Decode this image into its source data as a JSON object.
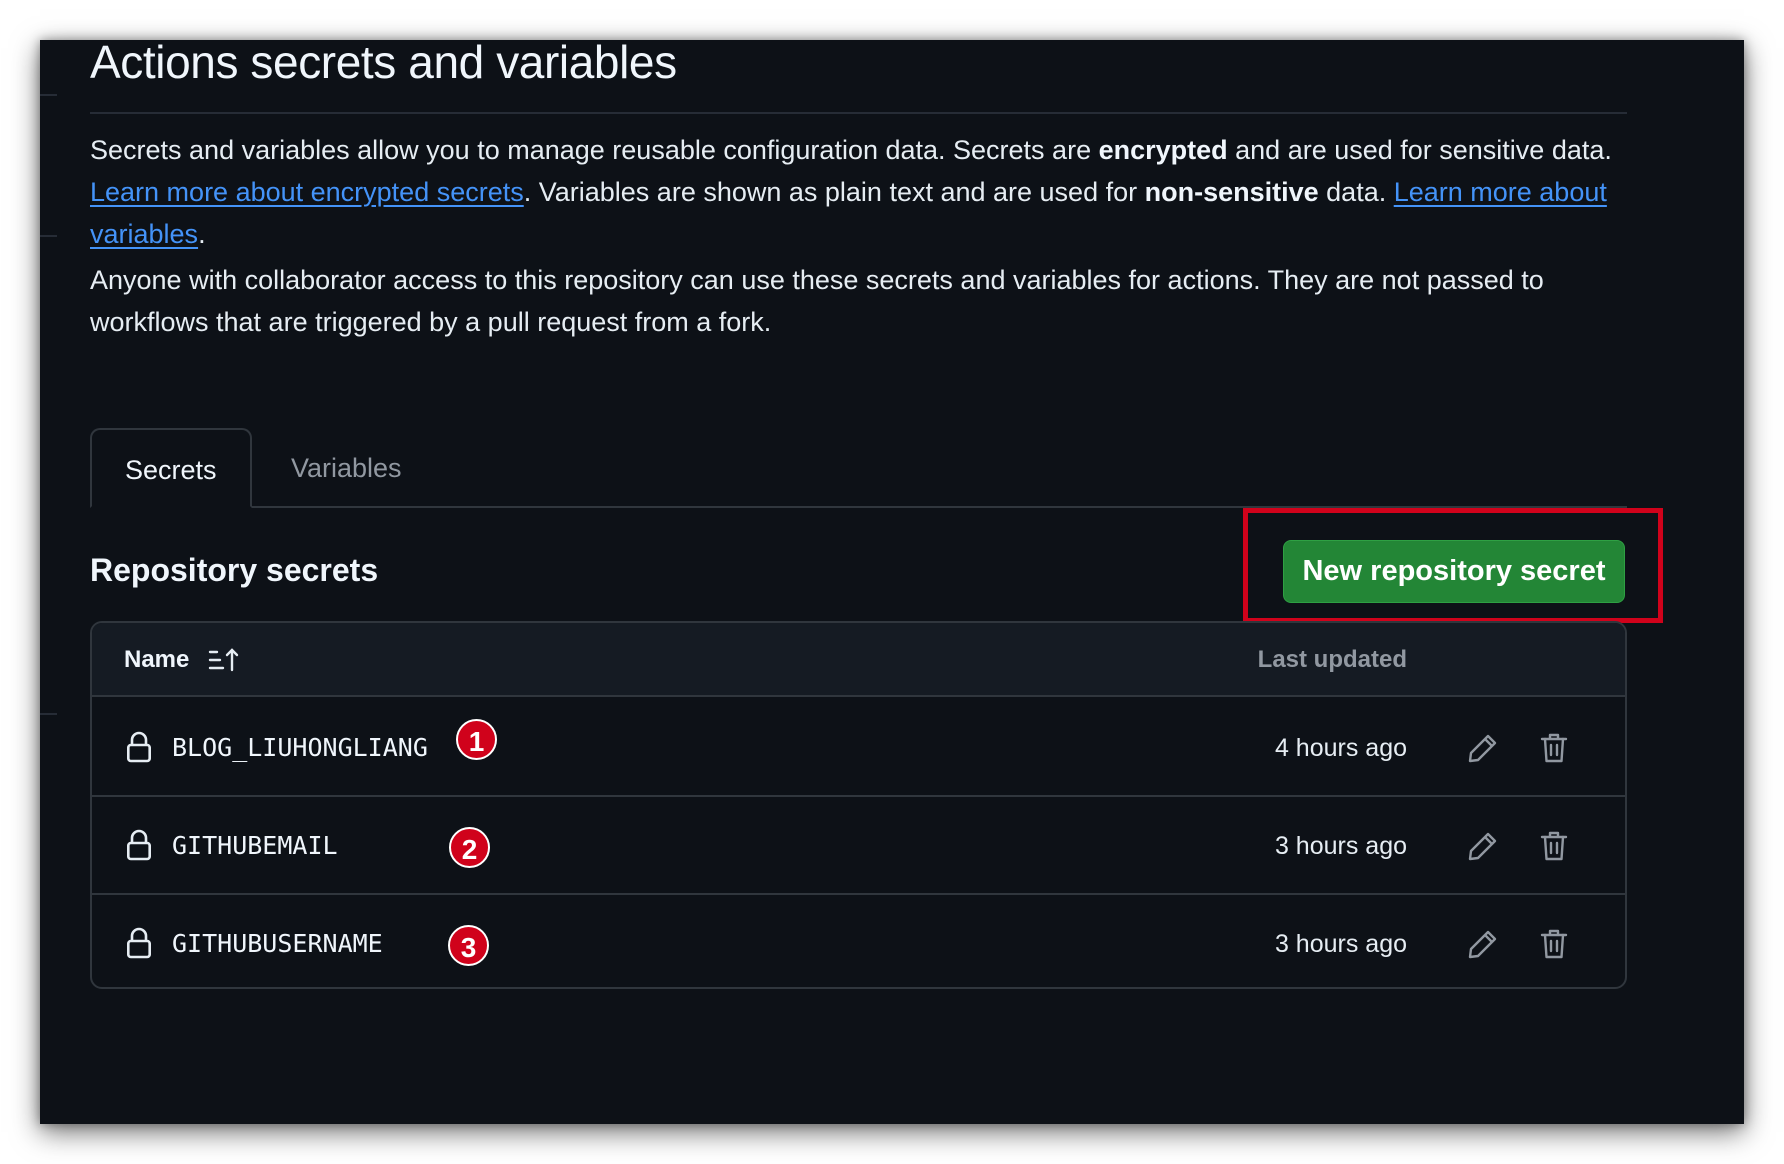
{
  "page": {
    "title": "Actions secrets and variables",
    "intro": {
      "t1": "Secrets and variables allow you to manage reusable configuration data. Secrets are ",
      "b1": "encrypted",
      "t2": " and are used for sensitive data. ",
      "link1": "Learn more about encrypted secrets",
      "t3": ". Variables are shown as plain text and are used for ",
      "b2": "non-sensitive",
      "t4": " data. ",
      "link2": "Learn more about variables",
      "t5": "."
    },
    "access_note": "Anyone with collaborator access to this repository can use these secrets and variables for actions. They are not passed to workflows that are triggered by a pull request from a fork."
  },
  "tabs": [
    {
      "label": "Secrets",
      "active": true
    },
    {
      "label": "Variables",
      "active": false
    }
  ],
  "section": {
    "title": "Repository secrets",
    "new_button_label": "New repository secret"
  },
  "table": {
    "col_name": "Name",
    "col_updated": "Last updated",
    "rows": [
      {
        "name": "BLOG_LIUHONGLIANG",
        "updated": "4 hours ago",
        "badge": "1"
      },
      {
        "name": "GITHUBEMAIL",
        "updated": "3 hours ago",
        "badge": "2"
      },
      {
        "name": "GITHUBUSERNAME",
        "updated": "3 hours ago",
        "badge": "3"
      }
    ]
  },
  "icons": {
    "lock": "lock-icon",
    "edit": "pencil-icon",
    "delete": "trash-icon",
    "sort": "sort-ascending-icon"
  },
  "colors": {
    "background": "#0d1117",
    "link": "#4493f8",
    "primary_button": "#238636",
    "annotation_red": "#d0021b",
    "border": "#30363d"
  }
}
